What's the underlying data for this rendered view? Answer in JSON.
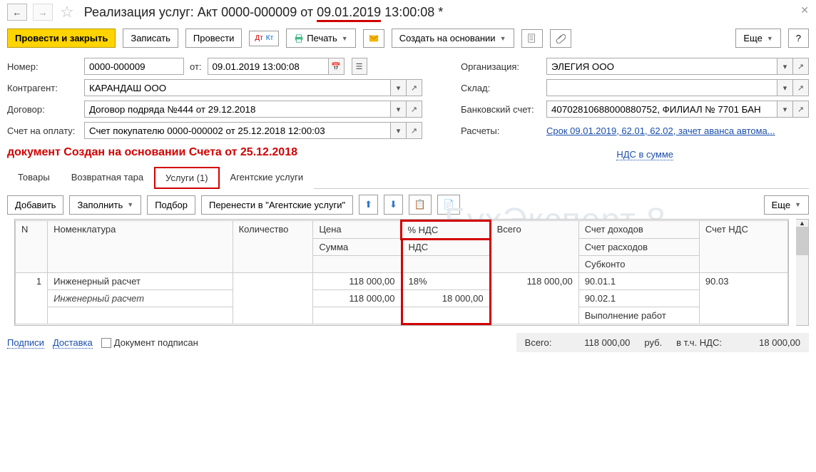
{
  "header": {
    "title_prefix": "Реализация услуг: Акт 0000-000009 от ",
    "title_date": "09.01.2019",
    "title_time": " 13:00:08 *"
  },
  "actions": {
    "post_close": "Провести и закрыть",
    "save": "Записать",
    "post": "Провести",
    "dtkt": "Дт Кт",
    "print": "Печать",
    "create_basis": "Создать на основании",
    "more": "Еще",
    "help": "?"
  },
  "form": {
    "number_label": "Номер:",
    "number": "0000-000009",
    "from_label": "от:",
    "date": "09.01.2019 13:00:08",
    "org_label": "Организация:",
    "org": "ЭЛЕГИЯ ООО",
    "contr_label": "Контрагент:",
    "contr": "КАРАНДАШ ООО",
    "warehouse_label": "Склад:",
    "warehouse": "",
    "contract_label": "Договор:",
    "contract": "Договор подряда №444 от 29.12.2018",
    "bank_label": "Банковский счет:",
    "bank": "40702810688000880752, ФИЛИАЛ № 7701 БАН",
    "invoice_label": "Счет на оплату:",
    "invoice": "Счет покупателю 0000-000002 от 25.12.2018 12:00:03",
    "calc_label": "Расчеты:",
    "calc_link": "Срок 09.01.2019, 62.01, 62.02, зачет аванса автома..."
  },
  "red_note": "документ Создан на основании Счета от 25.12.2018",
  "vat_link": "НДС в сумме",
  "tabs": {
    "goods": "Товары",
    "tare": "Возвратная тара",
    "services": "Услуги (1)",
    "agent": "Агентские услуги"
  },
  "sub": {
    "add": "Добавить",
    "fill": "Заполнить",
    "select": "Подбор",
    "move": "Перенести в \"Агентские услуги\"",
    "more": "Еще"
  },
  "table": {
    "h_n": "N",
    "h_nomenclature": "Номенклатура",
    "h_qty": "Количество",
    "h_price": "Цена",
    "h_sum": "Сумма",
    "h_vat_pct": "% НДС",
    "h_vat": "НДС",
    "h_total": "Всего",
    "h_income": "Счет доходов",
    "h_expense": "Счет расходов",
    "h_subconto": "Субконто",
    "h_vat_acc": "Счет НДС",
    "r1_n": "1",
    "r1_nom": "Инженерный расчет",
    "r1_nom2": "Инженерный расчет",
    "r1_price": "118 000,00",
    "r1_sum": "118 000,00",
    "r1_vat_pct": "18%",
    "r1_vat": "18 000,00",
    "r1_total": "118 000,00",
    "r1_income": "90.01.1",
    "r1_expense": "90.02.1",
    "r1_subconto": "Выполнение работ",
    "r1_vat_acc": "90.03"
  },
  "footer": {
    "signatures": "Подписи",
    "delivery": "Доставка",
    "signed": "Документ подписан",
    "total_label": "Всего:",
    "total": "118 000,00",
    "currency": "руб.",
    "vat_label": "в т.ч. НДС:",
    "vat": "18 000,00"
  },
  "watermark": "БухЭксперт   8"
}
